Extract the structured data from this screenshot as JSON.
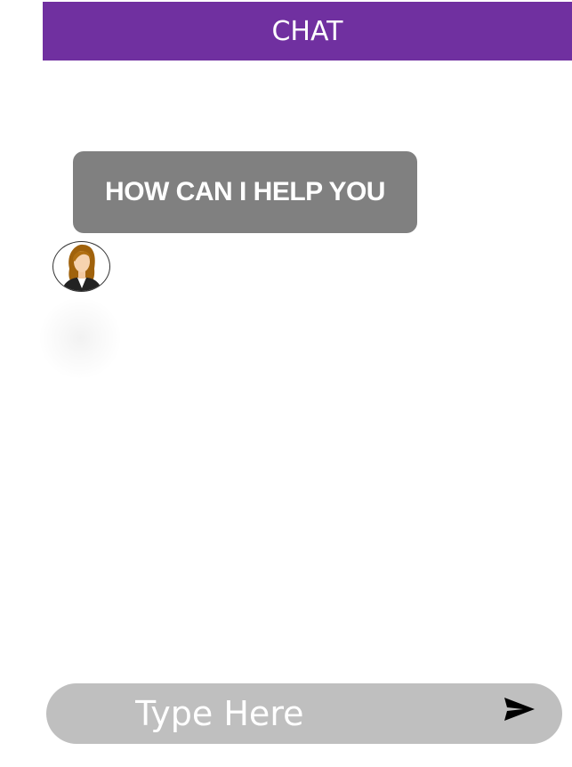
{
  "header": {
    "title": "CHAT"
  },
  "conversation": {
    "messages": [
      {
        "sender": "agent",
        "text": "HOW CAN I HELP YOU"
      }
    ],
    "avatar_icon": "female-agent-avatar-icon"
  },
  "composer": {
    "placeholder": "Type Here",
    "value": "",
    "send_icon": "send-icon"
  },
  "colors": {
    "header_bg": "#7030a0",
    "bubble_bg": "#808080",
    "input_bg": "#bfbfbf",
    "text_light": "#ffffff"
  }
}
